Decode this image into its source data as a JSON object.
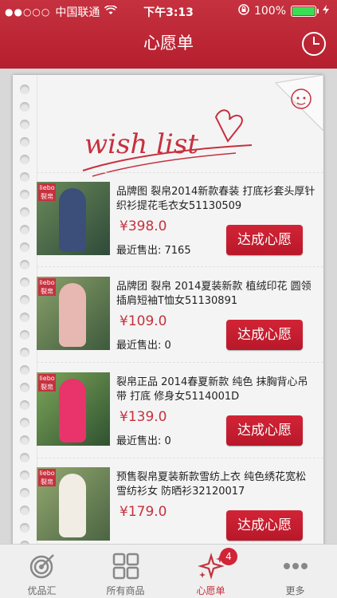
{
  "status_bar": {
    "carrier": "中国联通",
    "time": "下午3:13",
    "battery": "100%"
  },
  "nav": {
    "title": "心愿单"
  },
  "wish_list_art_text": "wish list",
  "items": [
    {
      "title": "品牌图 裂帛2014新款春装 打底衫套头厚针织衫提花毛衣女51130509",
      "price": "¥398.0",
      "sold_label": "最近售出: 7165",
      "button": "达成心愿",
      "badge": "liebo 裂帛"
    },
    {
      "title": "品牌团 裂帛 2014夏装新款 植绒印花 圆领插肩短袖T恤女51130891",
      "price": "¥109.0",
      "sold_label": "最近售出: 0",
      "button": "达成心愿",
      "badge": "liebo 裂帛"
    },
    {
      "title": "裂帛正品 2014春夏新款 纯色 抹胸背心吊带 打底 修身女5114001D",
      "price": "¥139.0",
      "sold_label": "最近售出: 0",
      "button": "达成心愿",
      "badge": "liebo 裂帛"
    },
    {
      "title": "预售裂帛夏装新款雪纺上衣 纯色绣花宽松雪纺衫女 防晒衫32120017",
      "price": "¥179.0",
      "sold_label": "",
      "button": "达成心愿",
      "badge": "liebo 裂帛"
    }
  ],
  "tabbar": {
    "tabs": [
      {
        "label": "优品汇",
        "icon": "target-icon"
      },
      {
        "label": "所有商品",
        "icon": "grid-icon"
      },
      {
        "label": "心愿单",
        "icon": "stars-icon",
        "badge": "4"
      },
      {
        "label": "更多",
        "icon": "more-icon"
      }
    ]
  },
  "colors": {
    "brand_red": "#c6313f",
    "tab_active": "#c6313f",
    "price": "#c6313f"
  }
}
